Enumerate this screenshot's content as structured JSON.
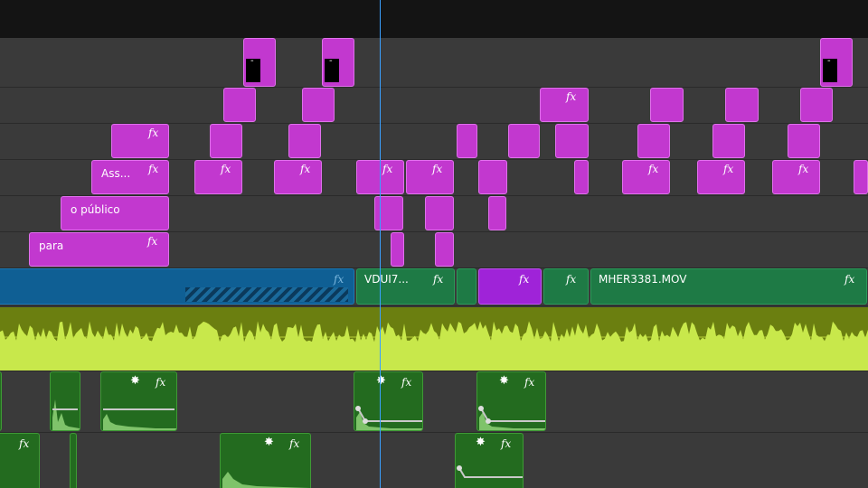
{
  "colors": {
    "graphic_clip": "#c238cf",
    "video_blue": "#0f5f94",
    "video_green": "#1e7a45",
    "video_purple": "#9f23d8",
    "audio_band": "#6b7f10",
    "waveform": "#c8e84b",
    "audio_clip": "#236b1f",
    "playhead": "#3aa0ff"
  },
  "icons": {
    "effect": "fx-badge-icon",
    "star": "sparkle-star-icon"
  },
  "effect_badge_text": "fx",
  "star_glyph": "✸",
  "graphics_tracks": {
    "clip_labels": {
      "assets": "Ass...",
      "o_publico": "o público",
      "para": "para"
    }
  },
  "video_track": {
    "clip_labels": {
      "vdui": "VDUI7...",
      "mher": "MHER3381.MOV"
    }
  }
}
